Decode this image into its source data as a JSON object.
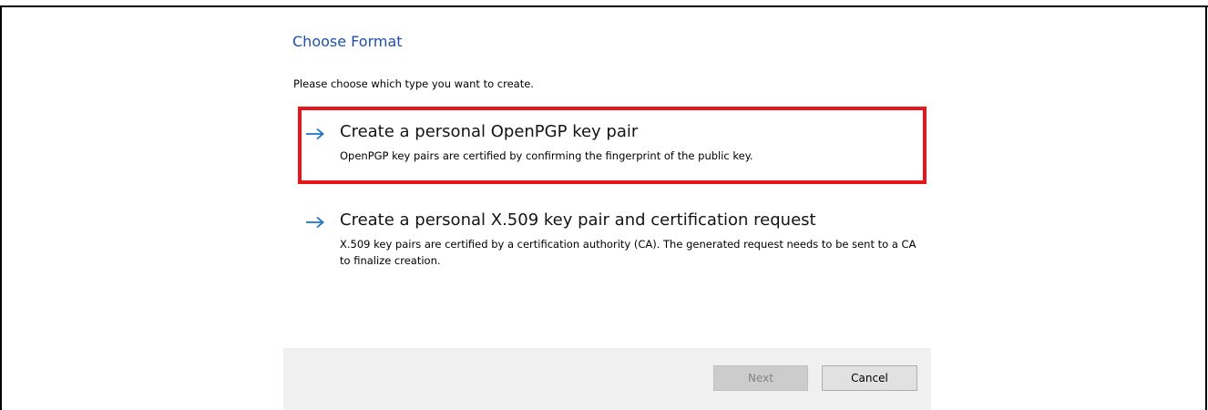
{
  "page": {
    "title": "Choose Format",
    "instructions": "Please choose which type you want to create."
  },
  "options": [
    {
      "icon": "arrow-right-icon",
      "title": "Create a personal OpenPGP key pair",
      "description": "OpenPGP key pairs are certified by confirming the fingerprint of the public key.",
      "highlighted": true
    },
    {
      "icon": "arrow-right-icon",
      "title": "Create a personal X.509 key pair and certification request",
      "description": "X.509 key pairs are certified by a certification authority (CA). The generated request needs to be sent to a CA to finalize creation.",
      "highlighted": false
    }
  ],
  "footer": {
    "next_label": "Next",
    "next_enabled": false,
    "cancel_label": "Cancel"
  },
  "colors": {
    "title": "#1f4fa8",
    "arrow": "#1a73c9",
    "highlight": "#e8151b",
    "footer_bg": "#f0f0f0"
  }
}
